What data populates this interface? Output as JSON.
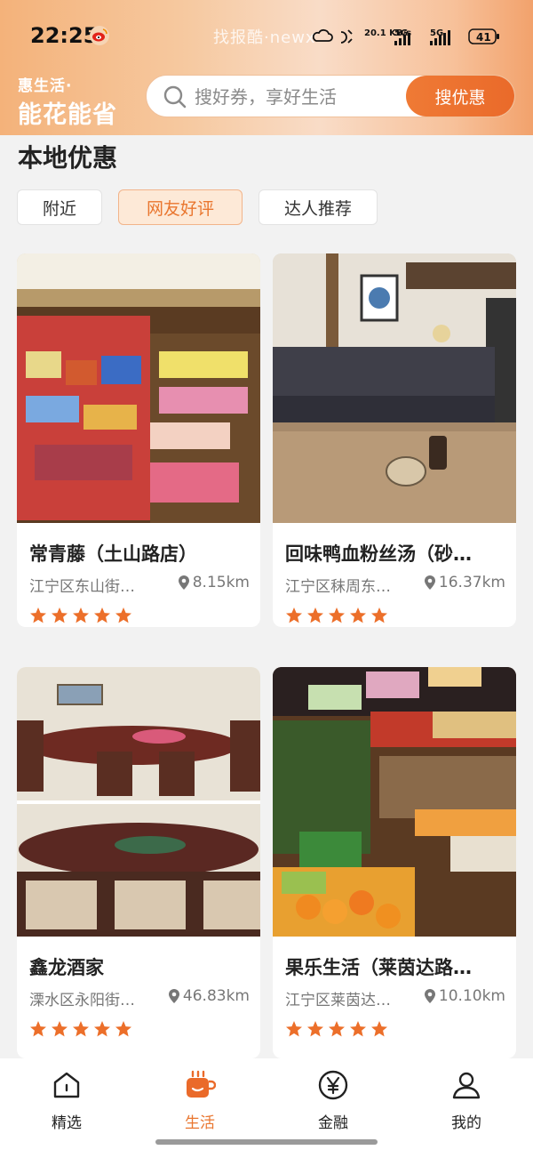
{
  "status_bar": {
    "time": "22:25",
    "watermark": "找报酷·newx",
    "network_speed": "20.1 KB/s",
    "network_type_1": "5G",
    "network_type_2": "5G",
    "battery": "41"
  },
  "header": {
    "brand_small": "惠生活·",
    "brand_big": "能花能省",
    "search_placeholder": "搜好券，享好生活",
    "search_button": "搜优惠"
  },
  "section": {
    "title": "本地优惠",
    "tabs": [
      {
        "label": "附近",
        "active": false
      },
      {
        "label": "网友好评",
        "active": true
      },
      {
        "label": "达人推荐",
        "active": false
      }
    ]
  },
  "cards": [
    {
      "name": "常青藤（土山路店）",
      "address": "江宁区东山街…",
      "distance": "8.15km",
      "stars": 5,
      "image": "store-shelves"
    },
    {
      "name": "回味鸭血粉丝汤（砂…",
      "address": "江宁区秣周东…",
      "distance": "16.37km",
      "stars": 5,
      "image": "restaurant-interior"
    },
    {
      "name": "鑫龙酒家",
      "address": "溧水区永阳街…",
      "distance": "46.83km",
      "stars": 5,
      "image": "banquet-room"
    },
    {
      "name": "果乐生活（莱茵达路…",
      "address": "江宁区莱茵达…",
      "distance": "10.10km",
      "stars": 5,
      "image": "fruit-store"
    }
  ],
  "bottom_nav": [
    {
      "label": "精选",
      "icon": "home-icon",
      "active": false
    },
    {
      "label": "生活",
      "icon": "coffee-cup-icon",
      "active": true
    },
    {
      "label": "金融",
      "icon": "yuan-icon",
      "active": false
    },
    {
      "label": "我的",
      "icon": "user-icon",
      "active": false
    }
  ],
  "colors": {
    "accent": "#ea6a2a",
    "star": "#ec6f2a",
    "active_tab_bg": "#fde9d7"
  }
}
